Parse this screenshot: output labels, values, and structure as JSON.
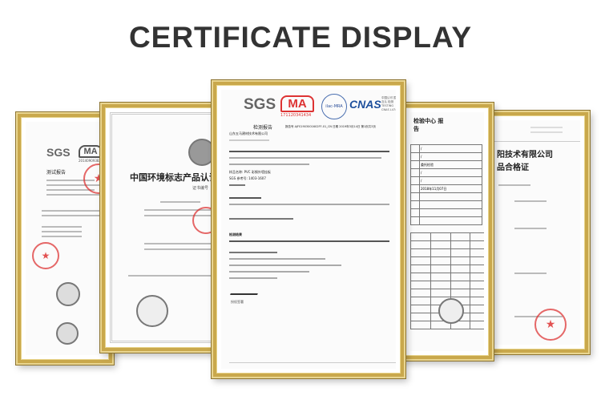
{
  "title": "CERTIFICATE DISPLAY",
  "certificates": {
    "left": {
      "logo1": "SGS",
      "logo2": "MA",
      "ma_number": "2014090938Z",
      "heading": "测试报告"
    },
    "second": {
      "heading": "中国环境标志产品认证",
      "sub": "证书编号"
    },
    "center": {
      "logo1": "SGS",
      "logo2": "MA",
      "ma_number": "171120341434",
      "logo3": "ilac-MRA",
      "logo4": "CNAS",
      "cnas_text": "中国认可 国际互认 检测 TESTING CNAS L4743",
      "heading": "检测报告",
      "report_no": "报告号 AJFS1903001602FF-01_CN 日期 2019年3月14日 第1页共3页",
      "company": "山东五马建材技术有限公司",
      "product_label": "样品名称: PVC 彩钢外墙挂板",
      "model_label": "SGS 参考号: 1403-1607",
      "summary_label": "检测结果",
      "signature_label": "授权签署"
    },
    "fourth": {
      "heading": "检验中心 报告",
      "rows": [
        "/",
        "/",
        "委托检验",
        "/",
        "/",
        "2018年11月07日"
      ]
    },
    "fifth": {
      "heading1": "阳技术有限公司",
      "heading2": "品合格证"
    }
  }
}
